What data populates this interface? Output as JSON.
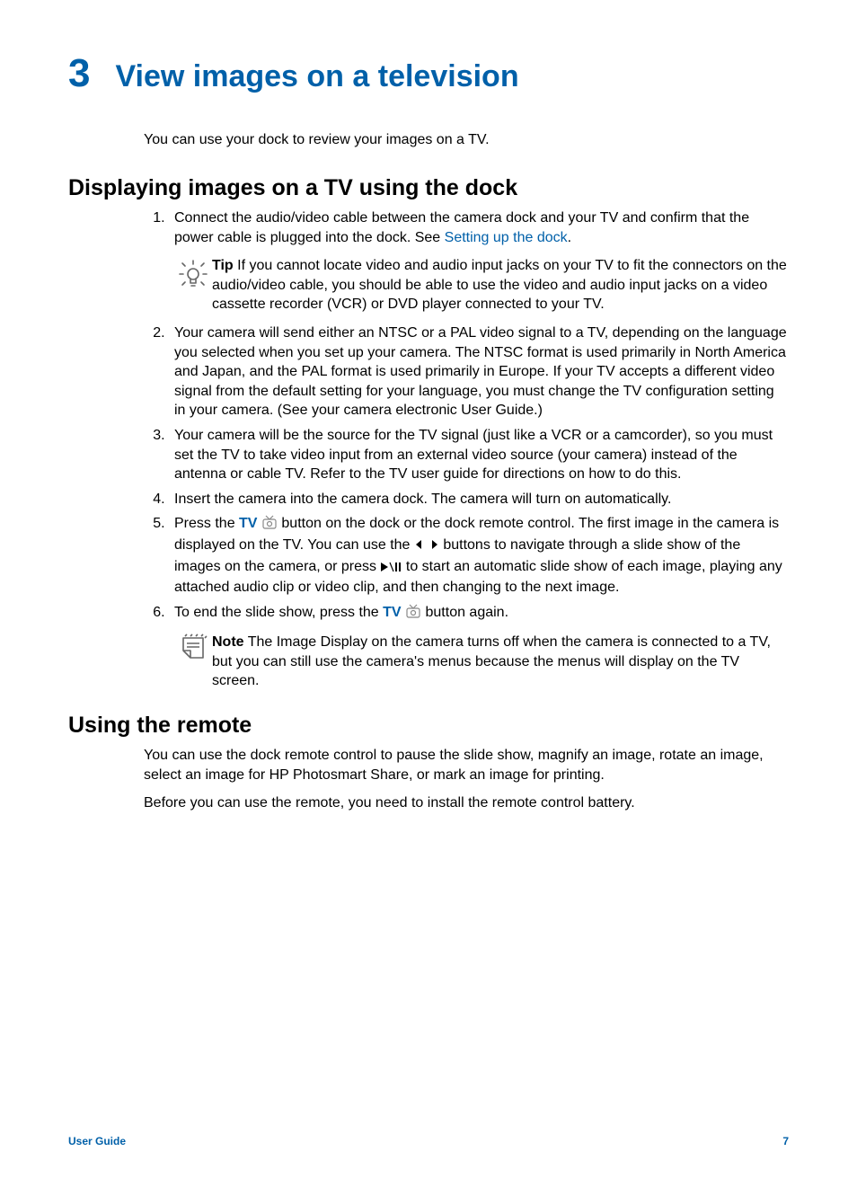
{
  "chapter": {
    "num": "3",
    "title": "View images on a television"
  },
  "intro": "You can use your dock to review your images on a TV.",
  "section1": {
    "heading": "Displaying images on a TV using the dock",
    "step1_a": "Connect the audio/video cable between the camera dock and your TV and confirm that the power cable is plugged into the dock. See ",
    "step1_link": "Setting up the dock",
    "step1_b": ".",
    "tip_label": "Tip",
    "tip_body": " If you cannot locate video and audio input jacks on your TV to fit the connectors on the audio/video cable, you should be able to use the video and audio input jacks on a video cassette recorder (VCR) or DVD player connected to your TV.",
    "step2": "Your camera will send either an NTSC or a PAL video signal to a TV, depending on the language you selected when you set up your camera. The NTSC format is used primarily in North America and Japan, and the PAL format is used primarily in Europe. If your TV accepts a different video signal from the default setting for your language, you must change the TV configuration setting in your camera. (See your camera electronic User Guide.)",
    "step3": "Your camera will be the source for the TV signal (just like a VCR or a camcorder), so you must set the TV to take video input from an external video source (your camera) instead of the antenna or cable TV. Refer to the TV user guide for directions on how to do this.",
    "step4": "Insert the camera into the camera dock. The camera will turn on automatically.",
    "step5_a": "Press the ",
    "tv_label": "TV",
    "step5_b": " button on the dock or the dock remote control. The first image in the camera is displayed on the TV. You can use the ",
    "step5_c": " buttons to navigate through a slide show of the images on the camera, or press ",
    "step5_d": " to start an automatic slide show of each image, playing any attached audio clip or video clip, and then changing to the next image.",
    "step6_a": "To end the slide show, press the ",
    "step6_b": " button again.",
    "note_label": "Note",
    "note_body": " The Image Display on the camera turns off when the camera is connected to a TV, but you can still use the camera's menus because the menus will display on the TV screen."
  },
  "section2": {
    "heading": "Using the remote",
    "p1": "You can use the dock remote control to pause the slide show, magnify an image, rotate an image, select an image for HP Photosmart Share, or mark an image for printing.",
    "p2": "Before you can use the remote, you need to install the remote control battery."
  },
  "footer": {
    "left": "User Guide",
    "right": "7"
  }
}
